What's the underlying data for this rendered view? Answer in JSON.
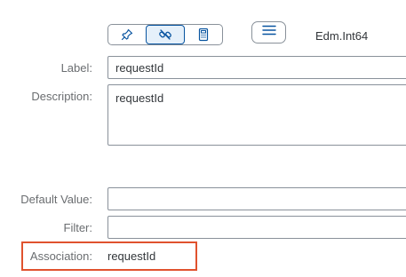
{
  "toolbar": {
    "segments": [
      {
        "icon": "pin-icon",
        "active": false
      },
      {
        "icon": "link-icon",
        "active": true
      },
      {
        "icon": "calculator-icon",
        "active": false
      }
    ],
    "menu_icon": "hamburger-menu-icon",
    "type_label": "Edm.Int64"
  },
  "form": {
    "label": {
      "caption": "Label:",
      "value": "requestId"
    },
    "description": {
      "caption": "Description:",
      "value": "requestId"
    },
    "default_value": {
      "caption": "Default Value:",
      "value": ""
    },
    "filter": {
      "caption": "Filter:",
      "value": ""
    },
    "association": {
      "caption": "Association:",
      "value": "requestId"
    }
  },
  "colors": {
    "highlight_border": "#e0522e",
    "active_segment_bg": "#e5f0fa",
    "active_segment_border": "#0854a0"
  }
}
